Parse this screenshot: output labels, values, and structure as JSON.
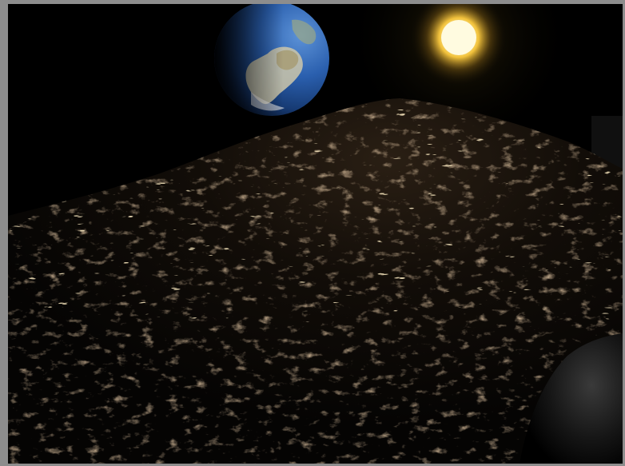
{
  "window": {
    "title": "",
    "scene": "lunar-surface-render"
  },
  "scene": {
    "objects": [
      {
        "name": "earth",
        "icon": "earth-globe"
      },
      {
        "name": "sun",
        "icon": "sun-glow"
      },
      {
        "name": "lunar-terrain",
        "icon": "terrain"
      },
      {
        "name": "foreground-shadow",
        "icon": "shadow"
      }
    ],
    "colors": {
      "background": "#8d8d8d",
      "space": "#000000",
      "sun_core": "#fffbe0",
      "sun_glow": "#f5c441",
      "earth_ocean": "#2b62b8",
      "earth_land": "#c9c3a8",
      "terrain_highlight": "#c89a6a"
    }
  }
}
